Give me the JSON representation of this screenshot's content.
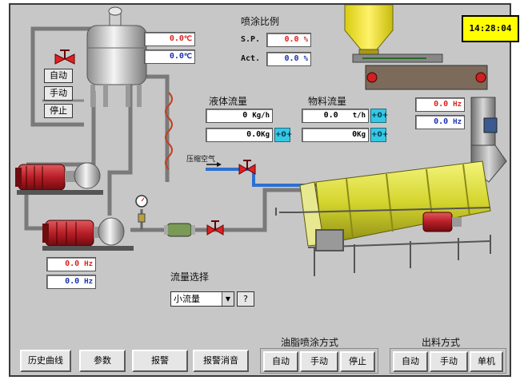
{
  "clock": "14:28:04",
  "tank": {
    "temp_values": [
      "0.0",
      "0.0"
    ],
    "temp_unit": "℃",
    "buttons": [
      "自动",
      "手动",
      "停止"
    ]
  },
  "spray_ratio": {
    "title": "喷涂比例",
    "sp_label": "S.P.",
    "sp_value": "0.0",
    "act_label": "Act.",
    "act_value": "0.0",
    "unit": "%"
  },
  "liquid_flow": {
    "title": "液体流量",
    "rate_value": "0",
    "rate_unit": "Kg/h",
    "total_value": "0.0",
    "total_unit": "Kg",
    "button": "+0+"
  },
  "material_flow": {
    "title": "物料流量",
    "rate_value": "0.0",
    "rate_unit": "t/h",
    "total_value": "0",
    "total_unit": "Kg",
    "button": "+0+"
  },
  "conveyor_freq": {
    "values": [
      "0.0",
      "0.0"
    ],
    "unit": "Hz"
  },
  "pump_freq": {
    "values": [
      "0.0",
      "0.0"
    ],
    "unit": "Hz"
  },
  "air_label": "压缩空气",
  "flow_select": {
    "title": "流量选择",
    "selected": "小流量",
    "help": "?"
  },
  "bottom_buttons": [
    "历史曲线",
    "参数",
    "报警",
    "报警消音"
  ],
  "oil_spray_mode": {
    "title": "油脂喷涂方式",
    "buttons": [
      "自动",
      "手动",
      "停止"
    ]
  },
  "discharge_mode": {
    "title": "出料方式",
    "buttons": [
      "自动",
      "手动",
      "单机"
    ]
  },
  "colors": {
    "panel": "#c7c7c7",
    "value_red": "#e0201c",
    "value_blue": "#1a2fb0",
    "drum": "#d8d838",
    "motor": "#c42a30",
    "hopper": "#f2ea2a"
  }
}
